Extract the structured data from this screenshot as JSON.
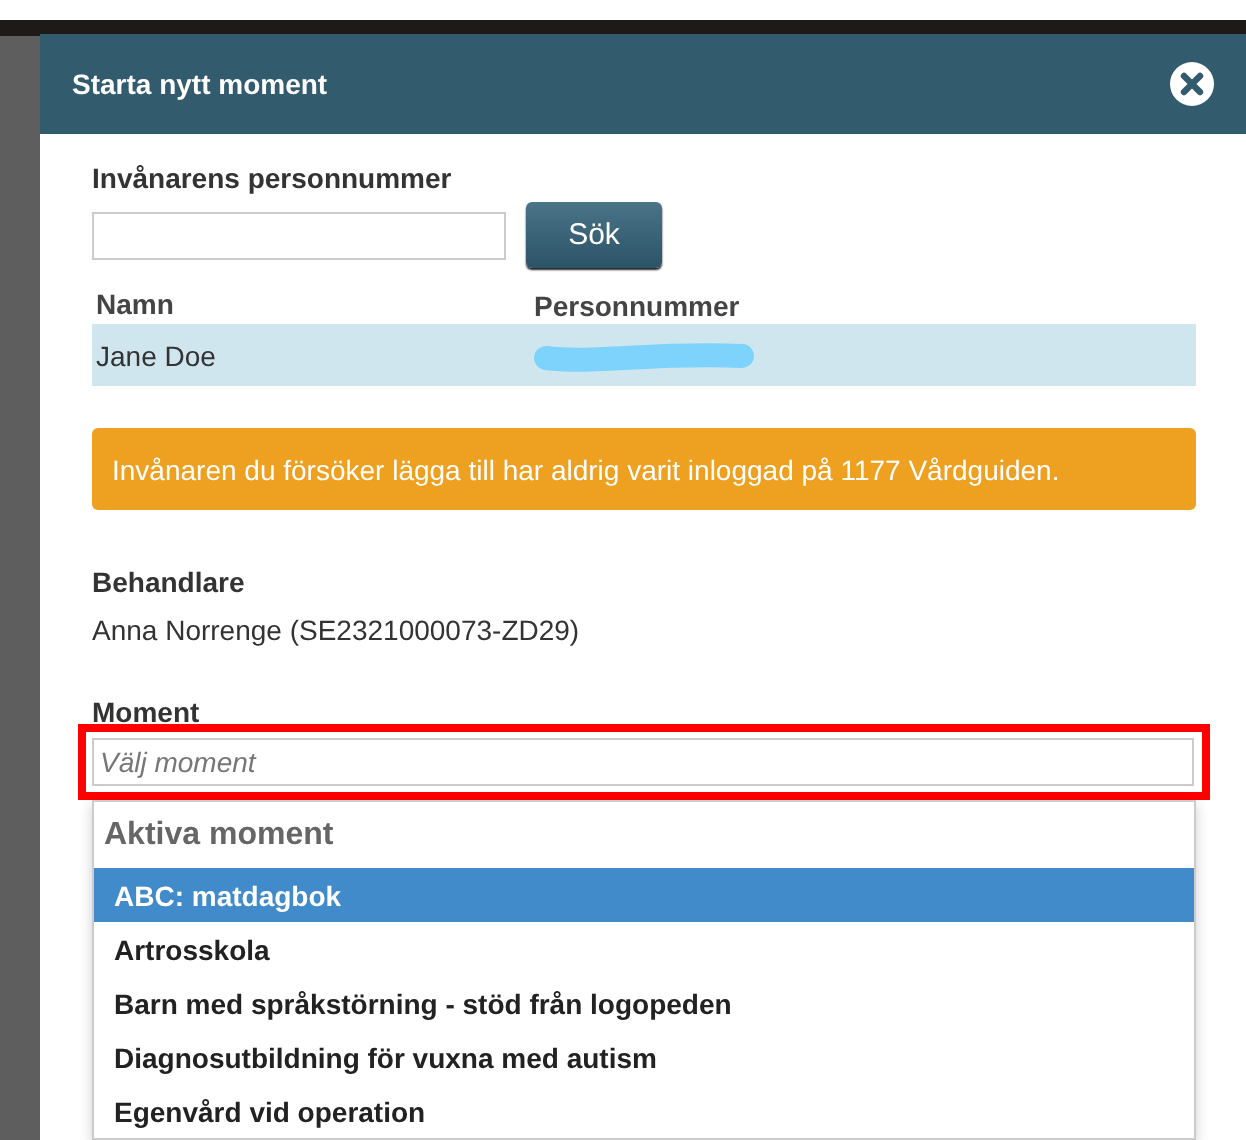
{
  "dialog": {
    "title": "Starta nytt moment"
  },
  "search": {
    "label": "Invånarens personnummer",
    "button": "Sök"
  },
  "results": {
    "columns": [
      "Namn",
      "Personnummer"
    ],
    "rows": [
      {
        "name": "Jane Doe",
        "personnummer_redacted": true
      }
    ]
  },
  "alert": {
    "text": "Invånaren du försöker lägga till har aldrig varit inloggad på 1177 Vårdguiden."
  },
  "treater": {
    "label": "Behandlare",
    "value": "Anna Norrenge (SE2321000073-ZD29)"
  },
  "moment": {
    "label": "Moment",
    "placeholder": "Välj moment",
    "highlighted": true,
    "group": "Aktiva moment",
    "options": [
      {
        "label": "ABC: matdagbok",
        "selected": true
      },
      {
        "label": "Artrosskola",
        "selected": false
      },
      {
        "label": "Barn med språkstörning - stöd från logopeden",
        "selected": false
      },
      {
        "label": "Diagnosutbildning för vuxna med autism",
        "selected": false
      },
      {
        "label": "Egenvård vid operation",
        "selected": false
      }
    ]
  }
}
